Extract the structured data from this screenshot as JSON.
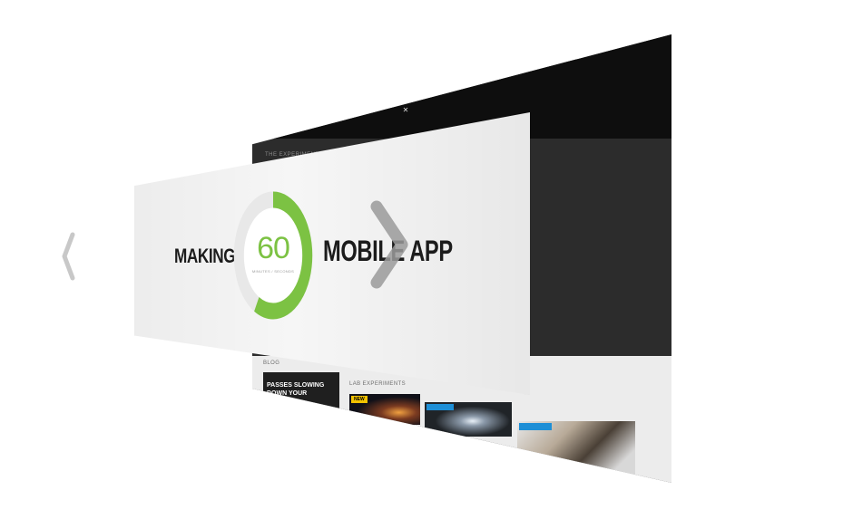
{
  "site": {
    "logo_glyph": "✕",
    "header_text": "THE EXPERIMENTS",
    "blog_label": "BLOG",
    "blog_post_title": "PASSES SLOWING DOWN YOUR",
    "lab_label": "LAB EXPERIMENTS",
    "thumbnails": [
      {
        "tag": "NEW",
        "tag_color": "#f2c200"
      },
      {
        "tag": "",
        "tag_color": "#1e8fd6"
      },
      {
        "tag": "",
        "tag_color": "#1e8fd6"
      }
    ],
    "colors": {
      "dark": "#2c2c2c",
      "topbar": "#0e0e0e",
      "light": "#ececec"
    }
  },
  "card": {
    "left_text": "MAKING A",
    "right_text": "MOBILE APP",
    "ring_value": "60",
    "ring_fraction": 0.58,
    "ring_caption": "MINUTES / SECONDS",
    "accent_color": "#7cc243"
  },
  "navigation": {
    "prev_icon": "chevron-left-icon",
    "next_icon": "chevron-right-icon"
  }
}
